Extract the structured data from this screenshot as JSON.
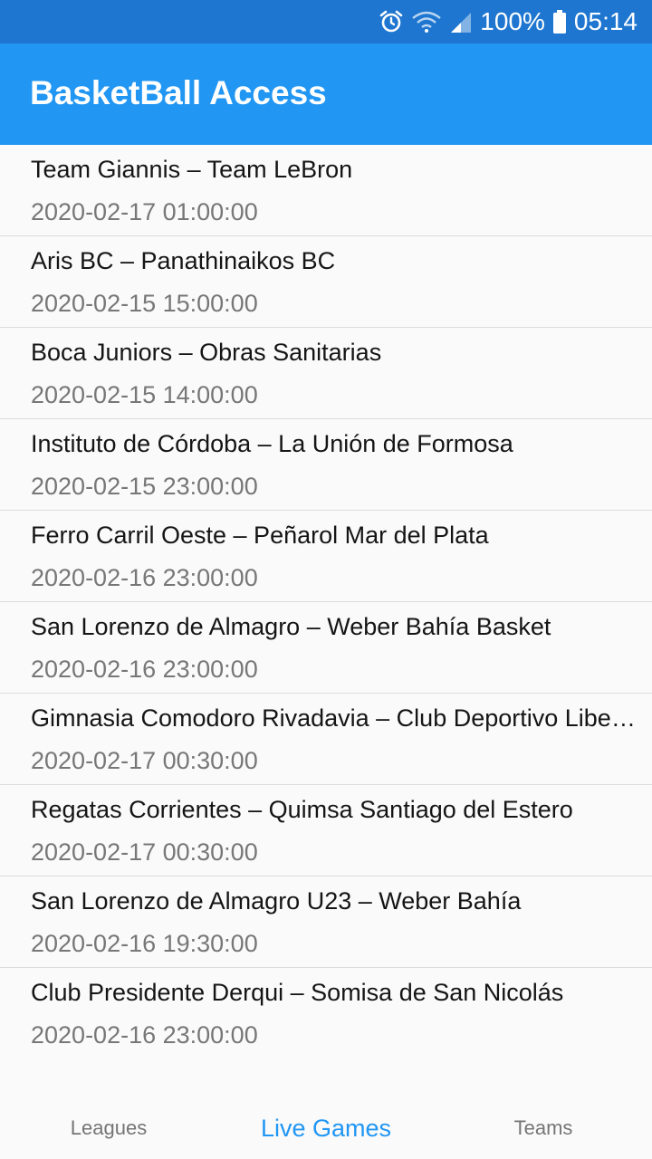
{
  "status_bar": {
    "icons": [
      "alarm-icon",
      "wifi-icon",
      "signal-icon",
      "battery-icon"
    ],
    "battery": "100%",
    "time": "05:14"
  },
  "app_bar": {
    "title": "BasketBall Access"
  },
  "games": [
    {
      "teams": "Team Giannis – Team LeBron",
      "time": "2020-02-17 01:00:00"
    },
    {
      "teams": "Aris BC – Panathinaikos BC",
      "time": "2020-02-15 15:00:00"
    },
    {
      "teams": "Boca Juniors – Obras Sanitarias",
      "time": "2020-02-15 14:00:00"
    },
    {
      "teams": "Instituto de Córdoba – La Unión de Formosa",
      "time": "2020-02-15 23:00:00"
    },
    {
      "teams": "Ferro Carril Oeste – Peñarol Mar del Plata",
      "time": "2020-02-16 23:00:00"
    },
    {
      "teams": "San Lorenzo de Almagro – Weber Bahía Basket",
      "time": "2020-02-16 23:00:00"
    },
    {
      "teams": "Gimnasia Comodoro Rivadavia – Club Deportivo Libe…",
      "time": "2020-02-17 00:30:00"
    },
    {
      "teams": "Regatas Corrientes – Quimsa Santiago del Estero",
      "time": "2020-02-17 00:30:00"
    },
    {
      "teams": "San Lorenzo de Almagro U23 – Weber Bahía",
      "time": "2020-02-16 19:30:00"
    },
    {
      "teams": "Club Presidente Derqui – Somisa de San Nicolás",
      "time": "2020-02-16 23:00:00"
    }
  ],
  "bottom_nav": {
    "tabs": [
      {
        "label": "Leagues",
        "active": false
      },
      {
        "label": "Live Games",
        "active": true
      },
      {
        "label": "Teams",
        "active": false
      }
    ]
  },
  "colors": {
    "status_bar": "#1e76d0",
    "app_bar": "#2196f3",
    "accent": "#2196f3",
    "background": "#fafafa",
    "secondary_text": "#777777"
  }
}
